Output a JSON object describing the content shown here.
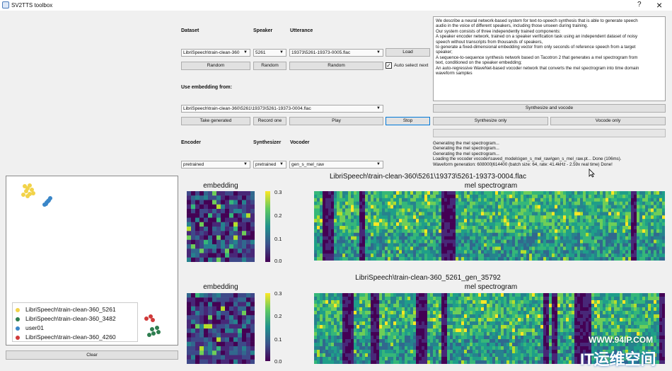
{
  "window": {
    "title": "SV2TTS toolbox",
    "help": "?",
    "close": "×"
  },
  "dataset": {
    "headers": {
      "dataset": "Dataset",
      "speaker": "Speaker",
      "utterance": "Utterance"
    },
    "dataset_value": "LibriSpeech\\train-clean-360",
    "speaker_value": "5261",
    "utterance_value": "19373\\5261-19373-0005.flac",
    "load": "Load",
    "random_dataset": "Random",
    "random_speaker": "Random",
    "random_utterance": "Random",
    "auto_select_label": "Auto select next",
    "auto_select_checked": "✓"
  },
  "embedding": {
    "heading": "Use embedding from:",
    "source_value": "LibriSpeech\\train-clean-360\\5261\\19373\\5261-19373-0004.flac",
    "take_generated": "Take generated",
    "record_one": "Record one",
    "play": "Play",
    "stop": "Stop"
  },
  "models": {
    "headers": {
      "encoder": "Encoder",
      "synthesizer": "Synthesizer",
      "vocoder": "Vocoder"
    },
    "encoder_value": "pretrained",
    "synthesizer_value": "pretrained",
    "vocoder_value": "gen_s_mel_raw"
  },
  "text_input": {
    "lines": [
      "We describe a neural network-based system for text-to-speech synthesis that is able to generate speech",
      "audio in the voice of different speakers, including those unseen during training.",
      "Our system consists of three independently trained components:",
      "A speaker encoder network, trained on a speaker verification task using an independent dataset of noisy",
      "speech without transcripts from thousands of speakers,",
      "to generate a fixed-dimensional embedding vector from only seconds of reference speech from a target",
      "speaker;",
      "A sequence-to-sequence synthesis network based on Tacotron 2 that generates a mel spectrogram from",
      "text, conditioned on the speaker embedding;",
      "An auto-regressive WaveNet-based vocoder network that converts the mel spectrogram into time domain",
      "waveform samples"
    ]
  },
  "synth": {
    "synthesize_and_vocode": "Synthesize and vocode",
    "synthesize_only": "Synthesize only",
    "vocode_only": "Vocode only"
  },
  "log": {
    "lines": [
      "Generating the mel spectrogram...",
      "Generating the mel spectrogram...",
      "Generating the mel spectrogram...",
      "Loading the vocoder vocoder\\saved_models\\gen_s_mel_raw\\gen_s_mel_raw.pt... Done (106ms).",
      "Waveform generation: 608000|614400 (batch size: 64, rate: 41.4kHz - 2.59x real time) Done!"
    ]
  },
  "projection": {
    "legend": [
      {
        "label": "LibriSpeech\\train-clean-360_5261",
        "color": "#f2d34a"
      },
      {
        "label": "LibriSpeech\\train-clean-360_3482",
        "color": "#2e7d4f"
      },
      {
        "label": "user01",
        "color": "#3a86c8"
      },
      {
        "label": "LibriSpeech\\train-clean-360_4260",
        "color": "#d03a3a"
      }
    ],
    "clear": "Clear"
  },
  "plots": [
    {
      "main_title": "LibriSpeech\\train-clean-360\\5261\\19373\\5261-19373-0004.flac",
      "embedding_title": "embedding",
      "spec_title": "mel spectrogram",
      "colorbar_ticks": [
        "0.3",
        "0.2",
        "0.1",
        "0.0"
      ]
    },
    {
      "main_title": "LibriSpeech\\train-clean-360_5261_gen_35792",
      "embedding_title": "embedding",
      "spec_title": "mel spectrogram",
      "colorbar_ticks": [
        "0.3",
        "0.2",
        "0.1",
        "0.0"
      ]
    }
  ],
  "watermark": {
    "url": "WWW.94IP.COM",
    "brand": "IT运维空间"
  }
}
